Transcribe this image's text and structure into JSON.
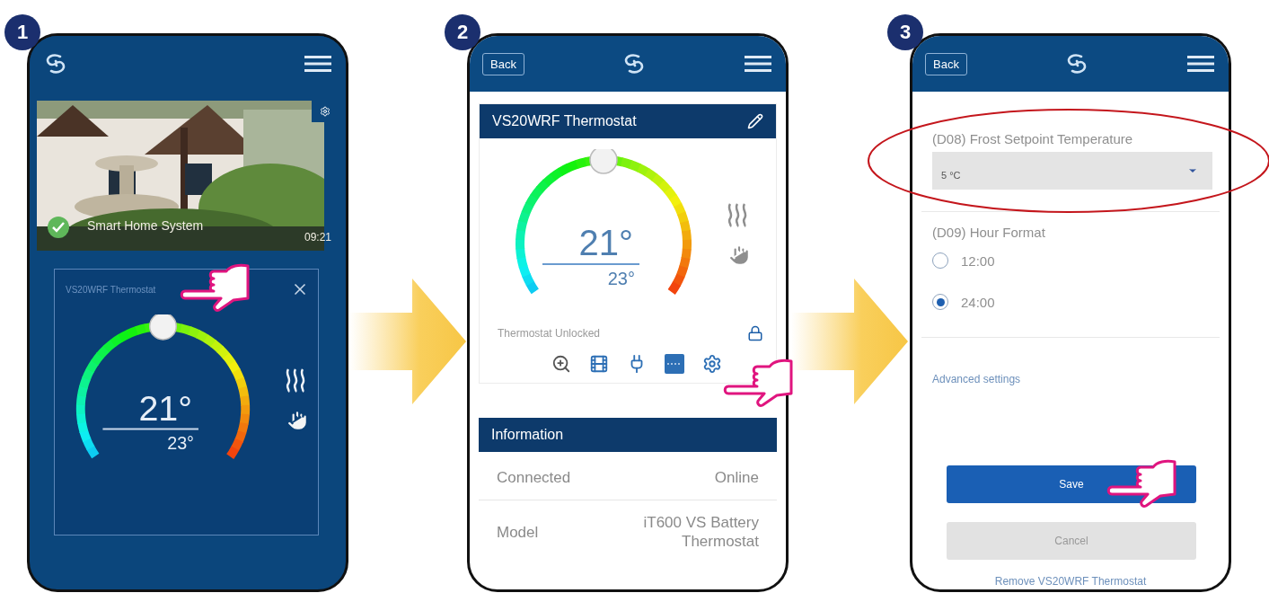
{
  "screens": [
    {
      "kind": "home",
      "step": "1",
      "camera": {
        "title": "Smart Home System",
        "time": "09:21"
      },
      "widget": {
        "title": "VS20WRF Thermostat",
        "setpoint": "21°",
        "current": "23°",
        "level": 0.5
      }
    },
    {
      "kind": "device",
      "step": "2",
      "back": "Back",
      "card": {
        "title": "VS20WRF Thermostat",
        "setpoint": "21°",
        "current": "23°",
        "level": 0.5,
        "lock_status": "Thermostat Unlocked"
      },
      "information": {
        "title": "Information",
        "rows": [
          {
            "label": "Connected",
            "value": "Online"
          },
          {
            "label": "Model",
            "value": "iT600 VS Battery Thermostat"
          }
        ]
      }
    },
    {
      "kind": "settings",
      "step": "3",
      "back": "Back",
      "frost": {
        "label": "(D08) Frost Setpoint Temperature",
        "value": "5 °C"
      },
      "hour_format": {
        "label": "(D09) Hour Format",
        "options": [
          {
            "label": "12:00",
            "selected": false
          },
          {
            "label": "24:00",
            "selected": true
          }
        ]
      },
      "advanced_link": "Advanced settings",
      "save": "Save",
      "cancel": "Cancel",
      "remove_link": "Remove VS20WRF Thermostat"
    }
  ]
}
